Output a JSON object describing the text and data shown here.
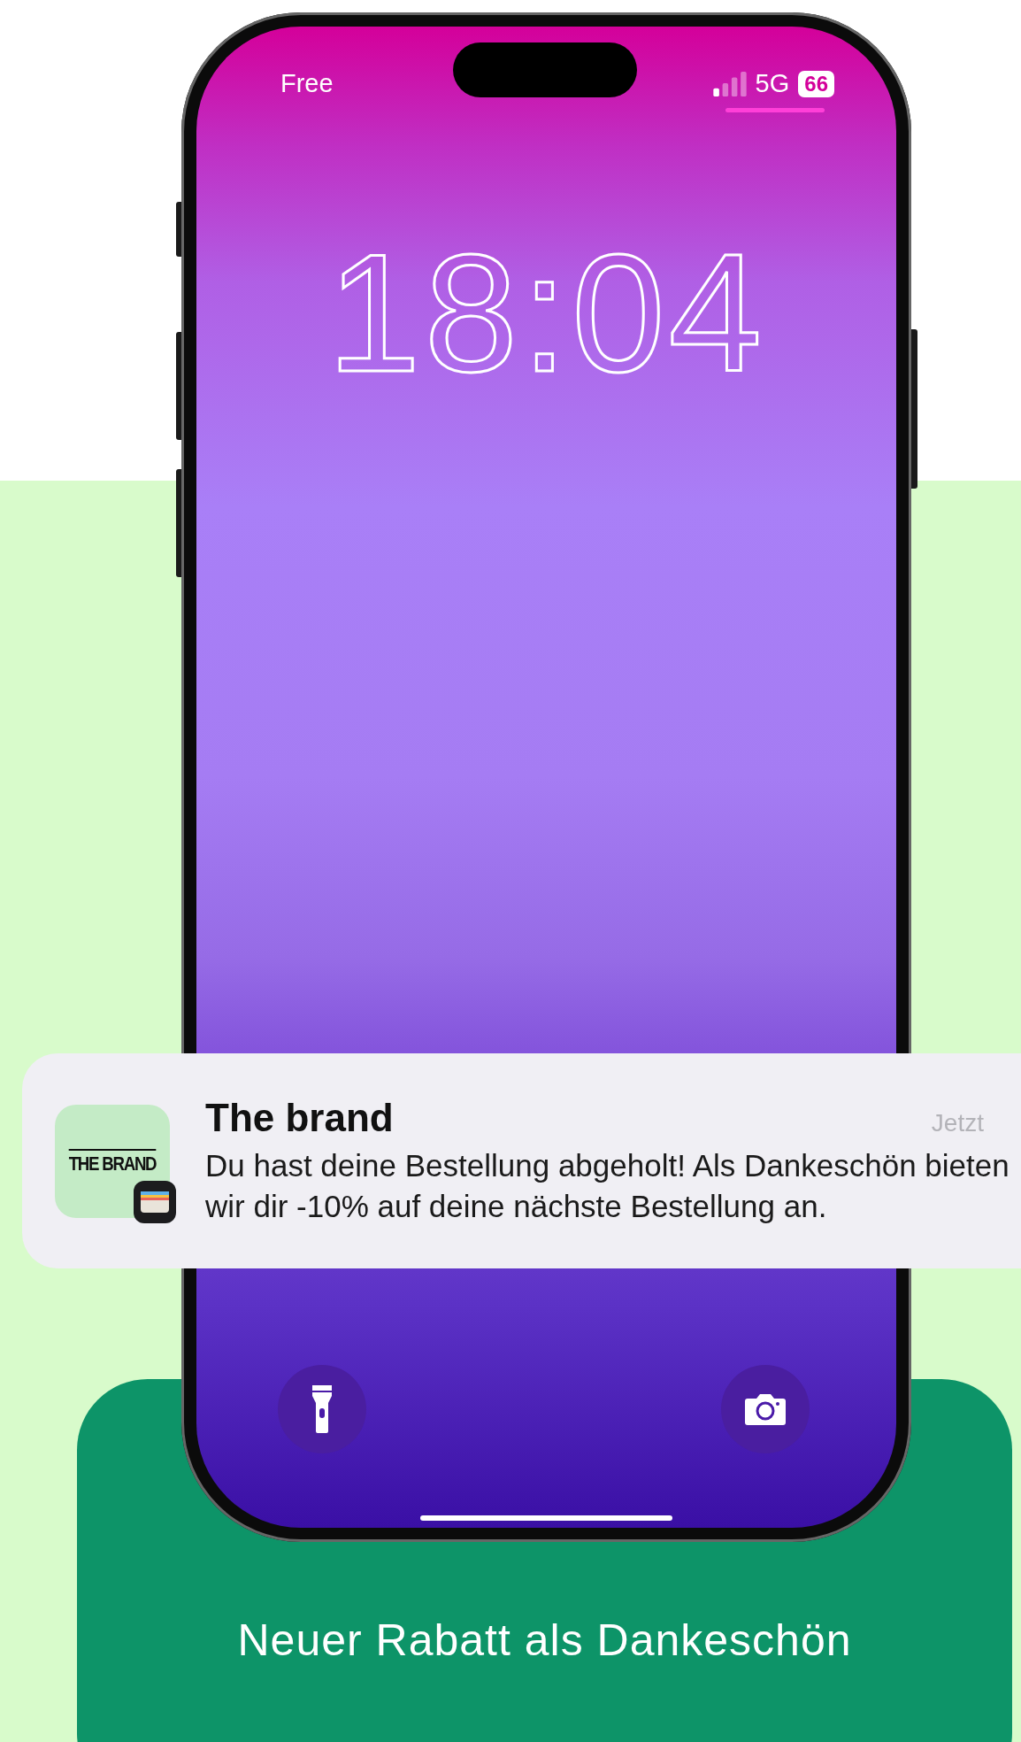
{
  "status_bar": {
    "carrier": "Free",
    "network": "5G",
    "battery": "66"
  },
  "lock_screen": {
    "time": "18:04"
  },
  "notification": {
    "logo_text": "THE BRAND",
    "app_name": "The brand",
    "time": "Jetzt",
    "message": "Du hast deine Bestellung abgeholt! Als Dankeschön bieten wir dir -10% auf deine nächste Bestellung an."
  },
  "caption": "Neuer Rabatt als Dankeschön"
}
